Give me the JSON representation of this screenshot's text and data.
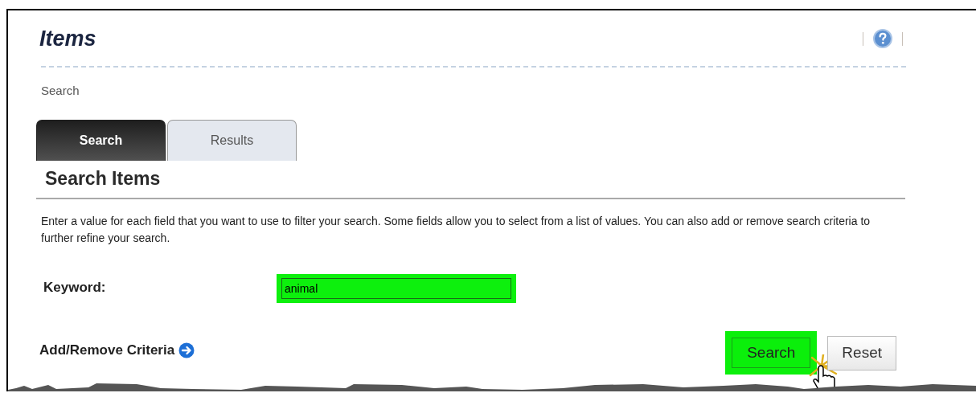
{
  "page": {
    "title": "Items",
    "breadcrumb": "Search"
  },
  "tabs": [
    {
      "label": "Search",
      "selected": true
    },
    {
      "label": "Results",
      "selected": false
    }
  ],
  "section": {
    "title": "Search Items",
    "description": "Enter a value for each field that you want to use to filter your search. Some fields allow you to select from a list of values. You can also add or remove search criteria to further refine your search."
  },
  "fields": [
    {
      "label": "Keyword:",
      "value": "animal",
      "highlighted": true
    }
  ],
  "criteria_link": "Add/Remove Criteria",
  "buttons": [
    {
      "label": "Search",
      "highlighted": true,
      "clicked": true
    },
    {
      "label": "Reset",
      "highlighted": false,
      "clicked": false
    }
  ]
}
